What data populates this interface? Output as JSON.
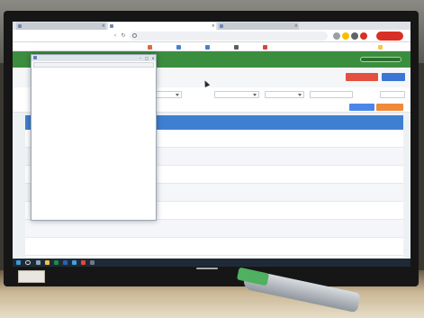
{
  "browser": {
    "tabs": [
      {
        "label": ""
      },
      {
        "label": ""
      },
      {
        "label": ""
      }
    ],
    "address_url": "",
    "bookmarks": [
      {
        "label": ""
      },
      {
        "label": ""
      },
      {
        "label": ""
      },
      {
        "label": ""
      },
      {
        "label": ""
      },
      {
        "label": ""
      }
    ]
  },
  "app": {
    "menu": [
      {
        "label": ""
      },
      {
        "label": ""
      },
      {
        "label": ""
      }
    ],
    "user_label": "",
    "action_buttons": {
      "primary": "",
      "secondary": ""
    }
  },
  "filters": {
    "selects": [
      {
        "label": ""
      },
      {
        "label": ""
      },
      {
        "label": ""
      },
      {
        "label": ""
      }
    ],
    "date": "",
    "search_label": "",
    "btn_blue": "",
    "btn_orange": ""
  },
  "table": {
    "headers": [
      "",
      "",
      "",
      "",
      "",
      "",
      "",
      "",
      "",
      "",
      "",
      "",
      "",
      "",
      "",
      "",
      ""
    ],
    "rows": [
      [
        "",
        "",
        "",
        "",
        "",
        "",
        "",
        "",
        "",
        "",
        "",
        "",
        "",
        "",
        "",
        "",
        ""
      ],
      [
        "",
        "",
        "",
        "",
        "",
        "",
        "",
        "",
        "",
        "",
        "",
        "",
        "",
        "",
        "",
        "",
        ""
      ],
      [
        "",
        "",
        "",
        "",
        "",
        "",
        "",
        "",
        "",
        "",
        "",
        "",
        "",
        "",
        "",
        "",
        ""
      ],
      [
        "",
        "",
        "",
        "",
        "",
        "",
        "",
        "",
        "",
        "",
        "",
        "",
        "",
        "",
        "",
        "",
        ""
      ],
      [
        "",
        "",
        "",
        "",
        "",
        "",
        "",
        "",
        "",
        "",
        "",
        "",
        "",
        "",
        "",
        "",
        ""
      ],
      [
        "",
        "",
        "",
        "",
        "",
        "",
        "",
        "",
        "",
        "",
        "",
        "",
        "",
        "",
        "",
        "",
        ""
      ],
      [
        "",
        "",
        "",
        "",
        "",
        "",
        "",
        "",
        "",
        "",
        "",
        "",
        "",
        "",
        "",
        "",
        ""
      ]
    ]
  },
  "popup": {
    "title": "",
    "url": "",
    "body_text": ""
  },
  "taskbar": {
    "time": "",
    "date": ""
  },
  "colors": {
    "header_green": "#3b8e3e",
    "table_header_blue": "#3f7fd1",
    "accent_red": "#e2503f",
    "accent_blue": "#3b76d6"
  }
}
